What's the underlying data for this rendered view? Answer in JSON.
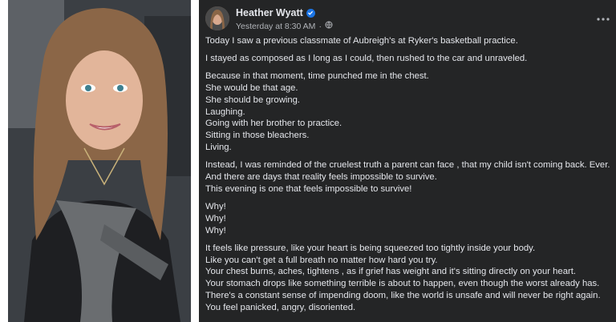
{
  "post": {
    "author": "Heather Wyatt",
    "timestamp": "Yesterday at 8:30 AM",
    "dot": "·",
    "paragraphs": [
      [
        "Today I saw a previous classmate of Aubreigh's at Ryker's basketball practice."
      ],
      [
        "I stayed as composed as I long as I could, then rushed to the car and unraveled."
      ],
      [
        "Because in that moment, time punched me in the chest.",
        "She would be that age.",
        "She should be growing.",
        "Laughing.",
        "Going with her brother to practice.",
        "Sitting in those bleachers.",
        "Living."
      ],
      [
        "Instead, I was reminded of the cruelest truth a parent can face , that my child isn't coming back. Ever.",
        "And there are days that reality feels impossible to survive.",
        "This evening is one that feels impossible to survive!"
      ],
      [
        "Why!",
        "Why!",
        "Why!"
      ],
      [
        "It feels like pressure, like your heart is being squeezed too tightly inside your body.",
        "Like you can't get a full breath no matter how hard you try.",
        "Your chest burns, aches, tightens , as if grief has weight and it's sitting directly on your heart.",
        "Your stomach drops like something terrible is about to happen, even though the worst already has.",
        "There's a constant sense of impending doom, like the world is unsafe and will never be right again.",
        "You feel panicked, angry, disoriented."
      ]
    ]
  },
  "icons": {
    "verified": "verified-badge-icon",
    "audience": "globe-icon",
    "more": "more-options-icon"
  },
  "colors": {
    "post_bg": "#242526",
    "text": "#e4e6eb",
    "muted": "#b0b3b8",
    "verified": "#1b74e4"
  }
}
